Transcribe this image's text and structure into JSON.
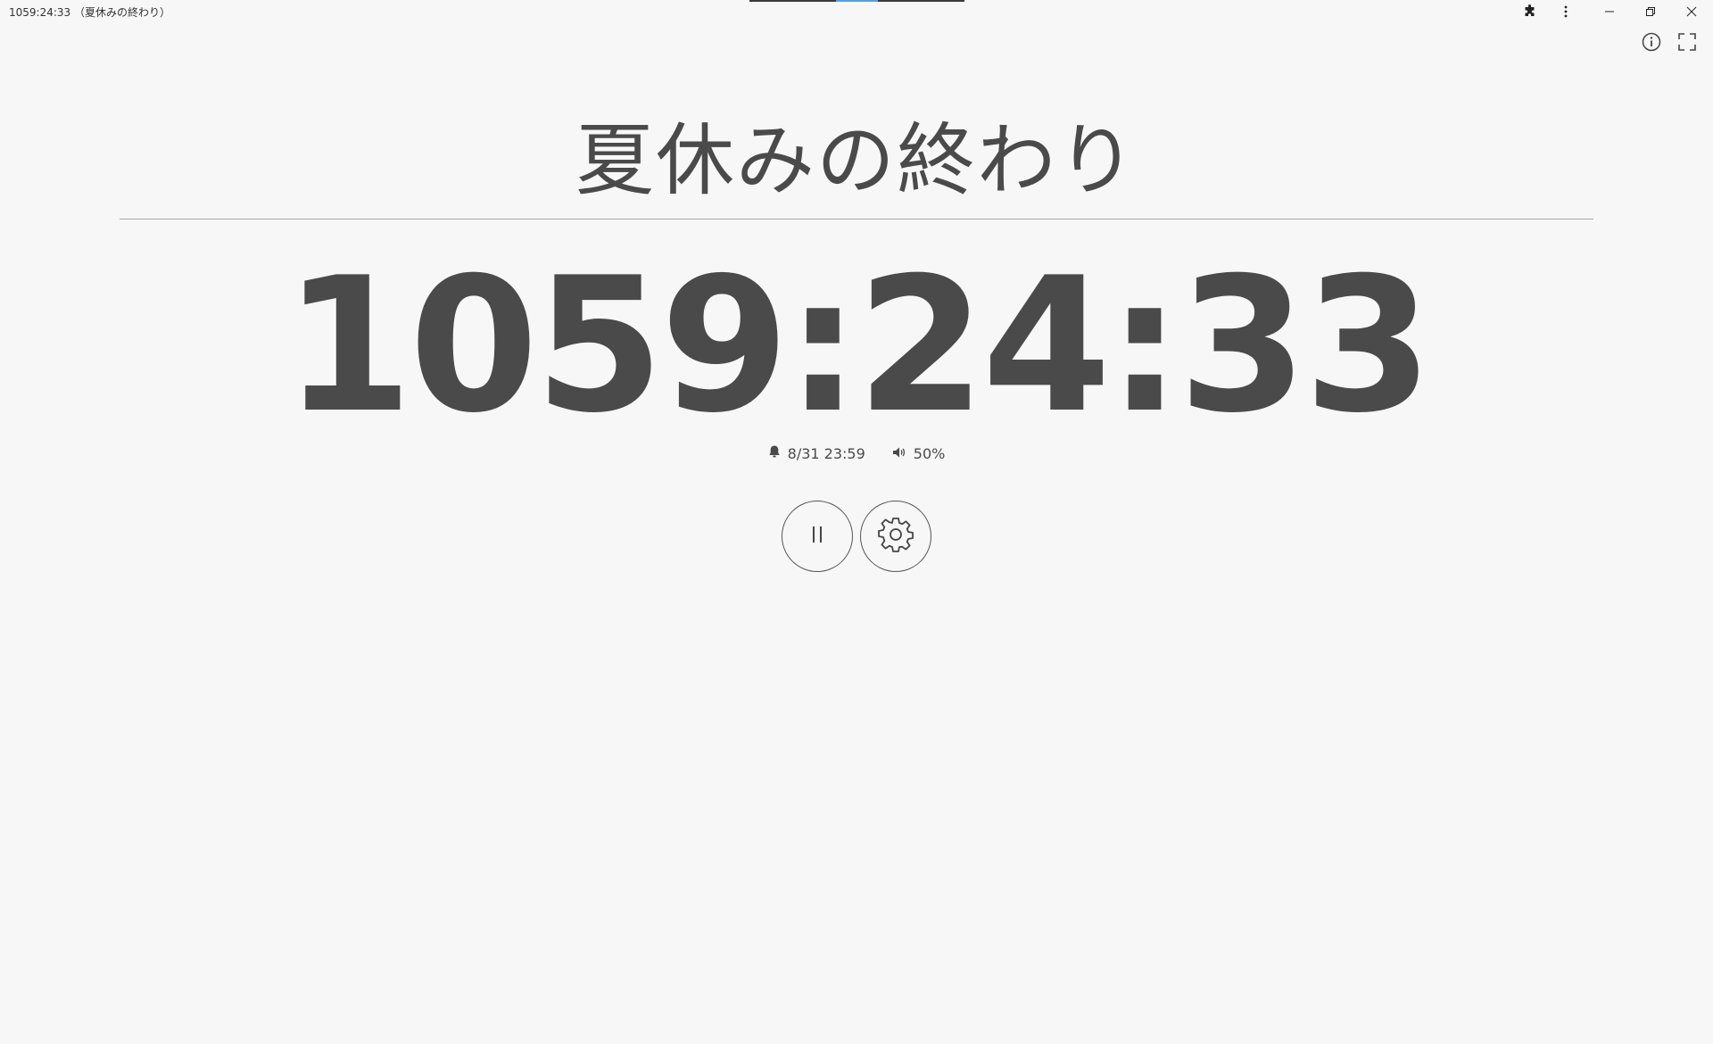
{
  "window": {
    "title": "1059:24:33 （夏休みの終わり）"
  },
  "titlebar_buttons": {
    "extensions_icon": "puzzle-icon",
    "menu_icon": "more-vertical-icon",
    "minimize_icon": "minimize-icon",
    "restore_icon": "restore-icon",
    "close_icon": "close-icon"
  },
  "corner_buttons": {
    "info_icon": "info-icon",
    "fullscreen_icon": "fullscreen-icon"
  },
  "timer": {
    "event_title": "夏休みの終わり",
    "countdown": "1059:24:33",
    "alarm_time": "8/31 23:59",
    "volume": "50%"
  },
  "controls": {
    "pause_icon": "pause-icon",
    "settings_icon": "gear-icon"
  },
  "colors": {
    "background": "#f7f7f7",
    "text": "#4a4a4a",
    "accent": "#5aa0d8"
  }
}
